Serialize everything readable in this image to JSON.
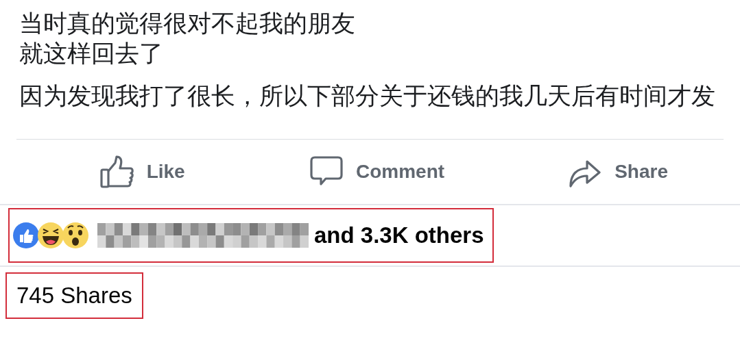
{
  "post": {
    "lines": [
      "当时真的觉得很对不起我的朋友",
      "就这样回去了",
      "因为发现我打了很长，所以下部分关于还钱的我几天后有时间才发"
    ]
  },
  "actions": [
    {
      "kind": "like",
      "label": "Like"
    },
    {
      "kind": "comment",
      "label": "Comment"
    },
    {
      "kind": "share",
      "label": "Share"
    }
  ],
  "reactions": {
    "reactors": [
      {
        "kind": "like"
      },
      {
        "kind": "haha"
      },
      {
        "kind": "wow"
      }
    ],
    "summary": "and 3.3K others",
    "highlighted": true
  },
  "shares": {
    "text": "745 Shares",
    "highlighted": true
  }
}
